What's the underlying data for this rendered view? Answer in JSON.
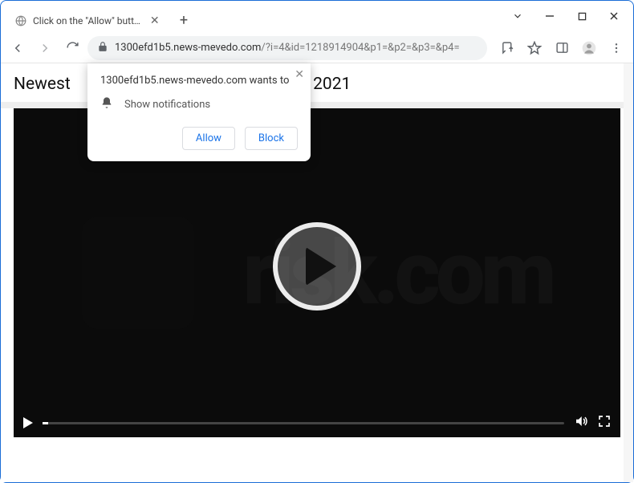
{
  "titlebar": {
    "tab_title": "Click on the \"Allow\" button to pl..."
  },
  "addressbar": {
    "host": "1300efd1b5.news-mevedo.com",
    "path": "/?i=4&id=1218914904&p1=&p2=&p3=&p4="
  },
  "page": {
    "heading_prefix": "Newest",
    "heading_suffix": "in 2021"
  },
  "popup": {
    "line1": "1300efd1b5.news-mevedo.com wants to",
    "line2": "Show notifications",
    "allow": "Allow",
    "block": "Block"
  },
  "watermark": {
    "text1": "risk",
    "dot": ".",
    "text2": "com"
  }
}
